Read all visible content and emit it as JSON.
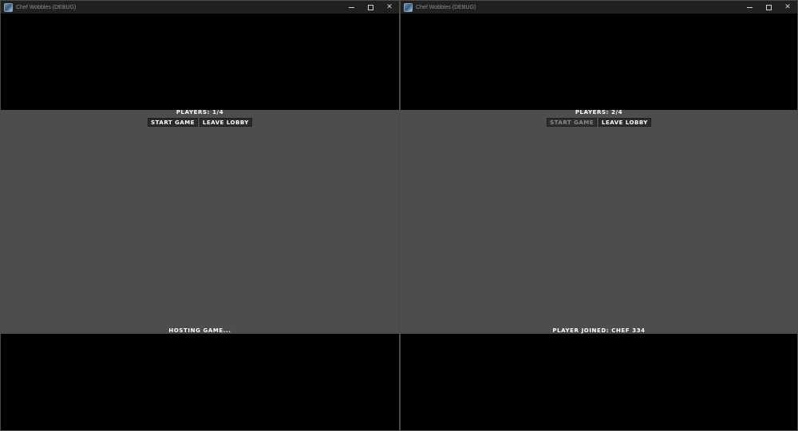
{
  "windows": [
    {
      "title": "Chef Wobbles (DEBUG)",
      "players_label": "PLAYERS: 1/4",
      "start_button": "START GAME",
      "start_enabled": true,
      "leave_button": "LEAVE LOBBY",
      "status": "HOSTING GAME..."
    },
    {
      "title": "Chef Wobbles (DEBUG)",
      "players_label": "PLAYERS: 2/4",
      "start_button": "START GAME",
      "start_enabled": false,
      "leave_button": "LEAVE LOBBY",
      "status": "PLAYER JOINED: CHEF 334"
    }
  ],
  "icons": {
    "app": "app-icon",
    "minimize": "minimize-icon",
    "maximize": "maximize-icon",
    "close": "close-icon"
  },
  "colors": {
    "panel": "#4d4d4d",
    "background": "#000000",
    "titlebar": "#202020",
    "button": "#2b2b2b",
    "disabled_text": "#8a8a8a"
  }
}
